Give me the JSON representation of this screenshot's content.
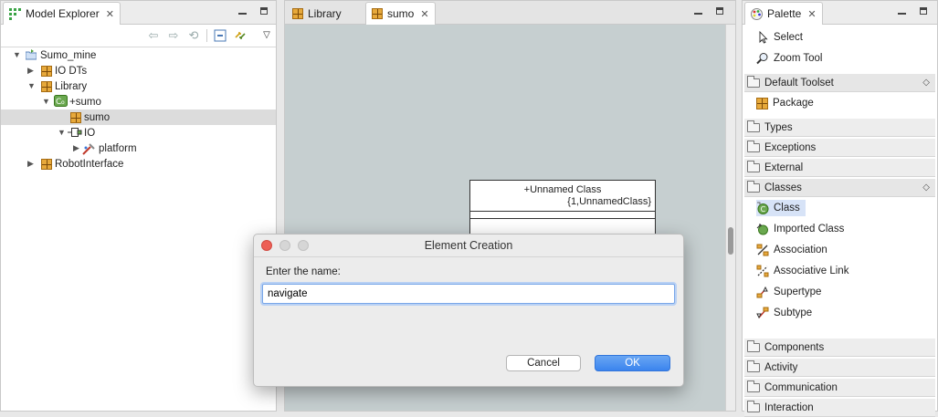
{
  "explorer": {
    "tab_label": "Model Explorer",
    "tree": [
      {
        "label": "Sumo_mine",
        "icon": "project-icon",
        "state": "expanded",
        "depth": 0
      },
      {
        "label": "IO DTs",
        "icon": "package-icon",
        "state": "collapsed",
        "depth": 1
      },
      {
        "label": "Library",
        "icon": "package-icon",
        "state": "expanded",
        "depth": 1
      },
      {
        "label": "+sumo",
        "icon": "class-icon",
        "state": "expanded",
        "depth": 2
      },
      {
        "label": "sumo",
        "icon": "package-icon",
        "state": "leaf",
        "depth": 3,
        "selected": true
      },
      {
        "label": "IO",
        "icon": "port-icon",
        "state": "expanded",
        "depth": 3
      },
      {
        "label": "platform",
        "icon": "tool-icon",
        "state": "collapsed",
        "depth": 4
      },
      {
        "label": "RobotInterface",
        "icon": "package-icon",
        "state": "collapsed",
        "depth": 1
      }
    ]
  },
  "editor": {
    "tabs": [
      {
        "label": "Library",
        "active": false
      },
      {
        "label": "sumo",
        "active": true
      }
    ],
    "uml_class": {
      "name": "+Unnamed Class",
      "subtitle": "{1,UnnamedClass}"
    }
  },
  "palette": {
    "tab_label": "Palette",
    "tools": [
      {
        "label": "Select",
        "icon": "cursor-arrow-icon"
      },
      {
        "label": "Zoom Tool",
        "icon": "magnifier-icon"
      }
    ],
    "drawers": [
      {
        "label": "Default Toolset",
        "open": true,
        "items": [
          {
            "label": "Package",
            "icon": "package-icon"
          }
        ]
      },
      {
        "label": "Types",
        "open": false
      },
      {
        "label": "Exceptions",
        "open": false
      },
      {
        "label": "External",
        "open": false
      },
      {
        "label": "Classes",
        "open": true,
        "items": [
          {
            "label": "Class",
            "icon": "class-icon",
            "selected": true
          },
          {
            "label": "Imported Class",
            "icon": "imported-class-icon"
          },
          {
            "label": "Association",
            "icon": "association-icon"
          },
          {
            "label": "Associative Link",
            "icon": "associative-link-icon"
          },
          {
            "label": "Supertype",
            "icon": "supertype-icon"
          },
          {
            "label": "Subtype",
            "icon": "subtype-icon"
          }
        ]
      },
      {
        "label": "Components",
        "open": false
      },
      {
        "label": "Activity",
        "open": false
      },
      {
        "label": "Communication",
        "open": false
      },
      {
        "label": "Interaction",
        "open": false
      }
    ]
  },
  "dialog": {
    "title": "Element Creation",
    "prompt": "Enter the name:",
    "input_value": "navigate",
    "cancel_label": "Cancel",
    "ok_label": "OK"
  }
}
